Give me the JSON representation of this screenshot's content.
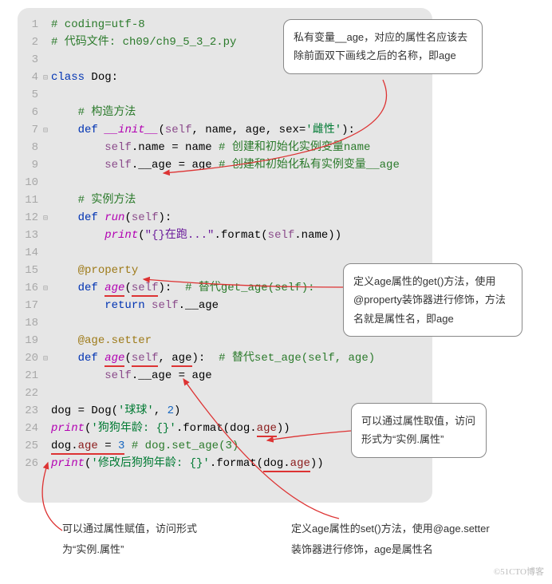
{
  "code": {
    "lines": [
      {
        "n": "1",
        "fold": "",
        "html": "<span class='c-comment'># coding=utf-8</span>"
      },
      {
        "n": "2",
        "fold": "",
        "html": "<span class='c-comment'># 代码文件: ch09/ch9_5_3_2.py</span>"
      },
      {
        "n": "3",
        "fold": "",
        "html": ""
      },
      {
        "n": "4",
        "fold": "⊟",
        "html": "<span class='c-keyword'>class</span> <span class='c-name'>Dog</span>:"
      },
      {
        "n": "5",
        "fold": "",
        "html": ""
      },
      {
        "n": "6",
        "fold": "",
        "html": "    <span class='c-comment'># 构造方法</span>"
      },
      {
        "n": "7",
        "fold": "⊟",
        "html": "    <span class='c-keyword'>def</span> <span class='c-func'>__init__</span>(<span class='c-self'>self</span>, name, age, sex=<span class='c-string'>'雌性'</span>):"
      },
      {
        "n": "8",
        "fold": "",
        "html": "        <span class='c-self'>self</span>.name = name <span class='c-comment'># 创建和初始化实例变量name</span>"
      },
      {
        "n": "9",
        "fold": "",
        "html": "        <span class='c-self'>self</span>.__age = age <span class='c-comment'># 创建和初始化私有实例变量__age</span>"
      },
      {
        "n": "10",
        "fold": "",
        "html": ""
      },
      {
        "n": "11",
        "fold": "",
        "html": "    <span class='c-comment'># 实例方法</span>"
      },
      {
        "n": "12",
        "fold": "⊟",
        "html": "    <span class='c-keyword'>def</span> <span class='c-func'>run</span>(<span class='c-self'>self</span>):"
      },
      {
        "n": "13",
        "fold": "",
        "html": "        <span class='c-func'>print</span>(<span class='c-str-purple'>\"{}在跑...\"</span>.format(<span class='c-self'>self</span>.name))"
      },
      {
        "n": "14",
        "fold": "",
        "html": ""
      },
      {
        "n": "15",
        "fold": "",
        "html": "    <span class='c-deco'>@property</span>"
      },
      {
        "n": "16",
        "fold": "⊟",
        "html": "    <span class='c-keyword'>def</span> <span class='c-func red-underline'>age</span>(<span class='c-self red-underline'>self</span>):  <span class='c-comment'># 替代get_age(self):</span>"
      },
      {
        "n": "17",
        "fold": "",
        "html": "        <span class='c-keyword'>return</span> <span class='c-self'>self</span>.__age"
      },
      {
        "n": "18",
        "fold": "",
        "html": ""
      },
      {
        "n": "19",
        "fold": "",
        "html": "    <span class='c-deco'>@age.setter</span>"
      },
      {
        "n": "20",
        "fold": "⊟",
        "html": "    <span class='c-keyword'>def</span> <span class='c-func red-underline'>age</span>(<span class='c-self red-underline'>self</span>, <span class='red-underline'>age</span>):  <span class='c-comment'># 替代set_age(self, age)</span>"
      },
      {
        "n": "21",
        "fold": "",
        "html": "        <span class='c-self'>self</span>.__age = age"
      },
      {
        "n": "22",
        "fold": "",
        "html": ""
      },
      {
        "n": "23",
        "fold": "",
        "html": "dog = Dog(<span class='c-string'>'球球'</span>, <span class='c-num'>2</span>)"
      },
      {
        "n": "24",
        "fold": "",
        "html": "<span class='c-func'>print</span>(<span class='c-string'>'狗狗年龄: {}'</span>.format(dog.<span class='c-attr red-underline'>age</span>))"
      },
      {
        "n": "25",
        "fold": "",
        "html": "<span class='red-underline'>dog.<span class='c-attr'>age</span> = <span class='c-num'>3</span></span> <span class='c-comment'># dog.set_age(3)</span>"
      },
      {
        "n": "26",
        "fold": "",
        "html": "<span class='c-func'>print</span>(<span class='c-string'>'修改后狗狗年龄: {}'</span>.format(<span class='red-underline'>dog.<span class='c-attr'>age</span></span>))"
      }
    ]
  },
  "annotations": {
    "box1": "私有变量__age，对应的属性名应该去除前面双下画线之后的名称，即age",
    "box2": "定义age属性的get()方法，使用@property装饰器进行修饰，方法名就是属性名，即age",
    "box3": "可以通过属性取值，访问形式为“实例.属性”",
    "caption_left": "可以通过属性赋值，访问形式为“实例.属性”",
    "caption_right": "定义age属性的set()方法，使用@age.setter装饰器进行修饰，age是属性名"
  },
  "watermark": "©51CTO博客"
}
